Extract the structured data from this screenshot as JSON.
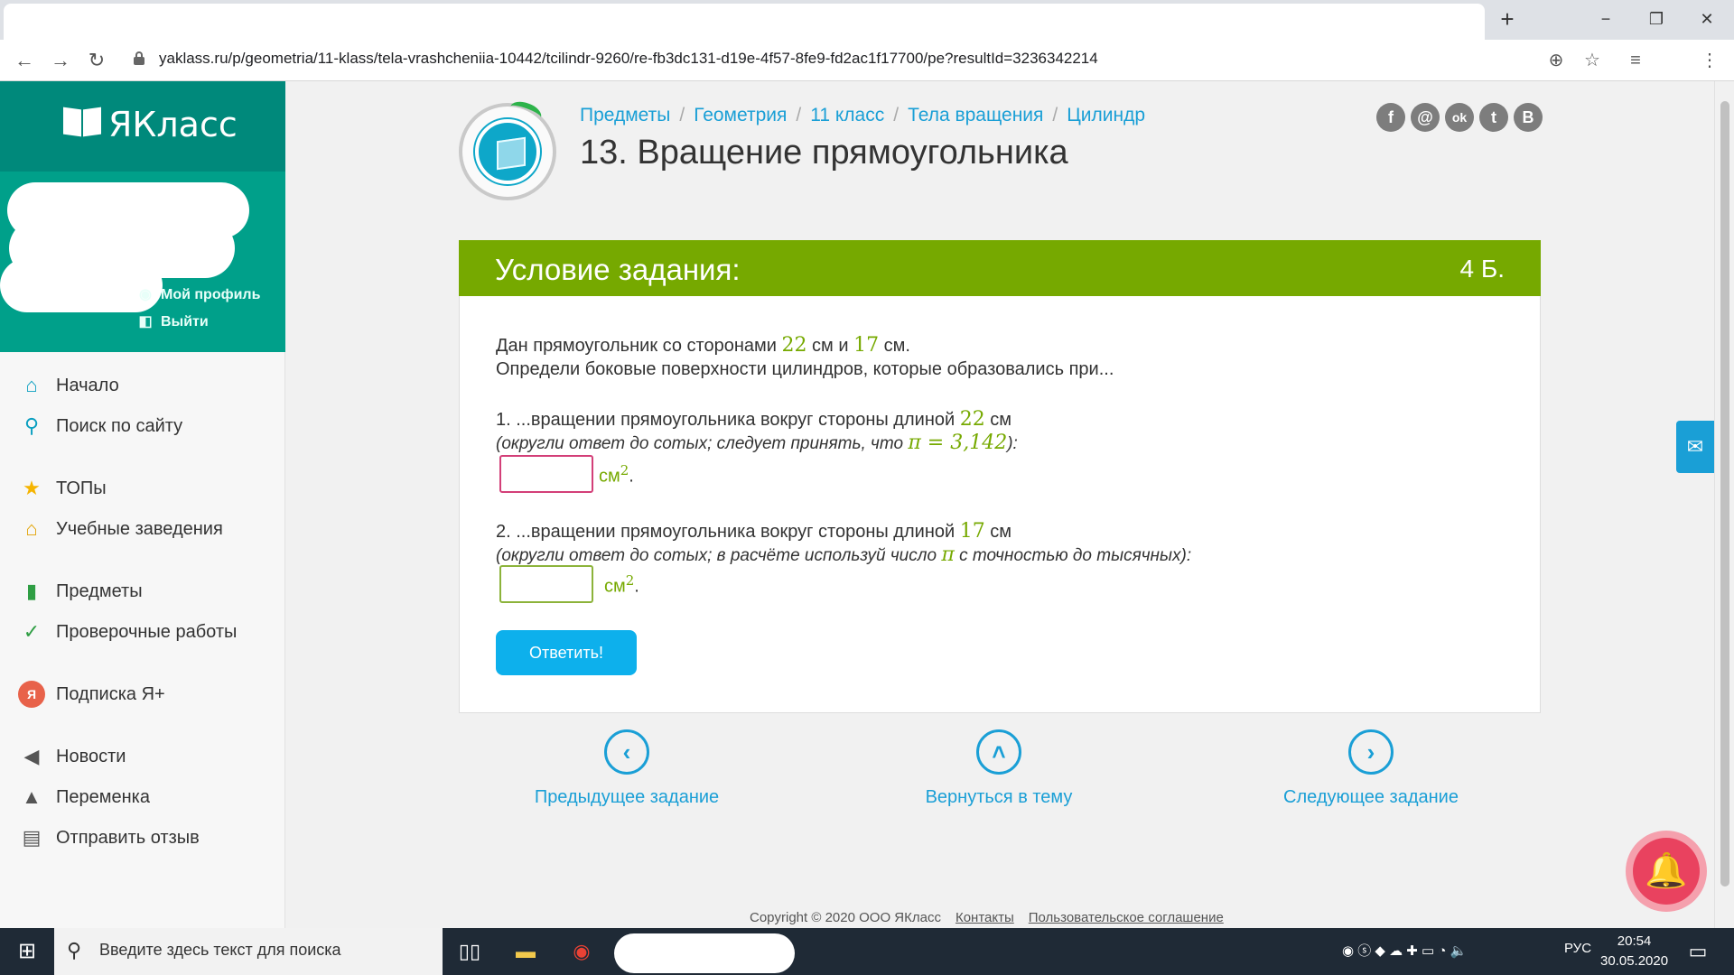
{
  "browser": {
    "url": "yaklass.ru/p/geometria/11-klass/tela-vrashcheniia-10442/tcilindr-9260/re-fb3dc131-d19e-4f57-8fe9-fd2ac1f17700/pe?resultId=3236342214",
    "new_tab": "+",
    "minimize": "−",
    "maximize": "❐",
    "close": "✕",
    "back": "←",
    "forward": "→",
    "reload": "↻",
    "add_icon": "⊕",
    "star_icon": "☆",
    "media_icon": "≡",
    "menu_icon": "⋮"
  },
  "sidebar": {
    "brand": "ЯКласс",
    "my_profile": "Мой профиль",
    "logout": "Выйти",
    "items": [
      {
        "label": "Начало",
        "icon": "⌂"
      },
      {
        "label": "Поиск по сайту",
        "icon": "⚲"
      },
      {
        "label": "ТОПы",
        "icon": "★"
      },
      {
        "label": "Учебные заведения",
        "icon": "⌂"
      },
      {
        "label": "Предметы",
        "icon": "▮"
      },
      {
        "label": "Проверочные работы",
        "icon": "✓"
      },
      {
        "label": "Подписка Я+",
        "icon": "Я"
      },
      {
        "label": "Новости",
        "icon": "◀"
      },
      {
        "label": "Переменка",
        "icon": "▲"
      },
      {
        "label": "Отправить отзыв",
        "icon": "▤"
      }
    ]
  },
  "breadcrumbs": [
    "Предметы",
    "Геометрия",
    "11 класс",
    "Тела вращения",
    "Цилиндр"
  ],
  "page_title": "13. Вращение прямоугольника",
  "social": [
    "f",
    "@",
    "ok",
    "t",
    "B"
  ],
  "task": {
    "header": "Условие задания:",
    "points": "4 Б.",
    "line1_a": "Дан прямоугольник со сторонами ",
    "side_a": "22",
    "line1_b": " см и ",
    "side_b": "17",
    "line1_c": " см.",
    "line2": "Определи боковые поверхности цилиндров, которые образовались при...",
    "q1_text": "1. ...вращении прямоугольника вокруг стороны длиной ",
    "q1_num": "22",
    "q1_unit": " см",
    "q1_hint_a": "(округли ответ до сотых; следует принять, что ",
    "q1_pi": "π = 3,142",
    "q1_hint_b": "):",
    "q2_text": "2. ...вращении прямоугольника вокруг стороны длиной ",
    "q2_num": "17",
    "q2_unit": " см",
    "q2_hint_a": "(округли ответ до сотых; в расчёте используй число ",
    "q2_pi": "π",
    "q2_hint_b": " с точностью до тысячных):",
    "answer_unit": "см",
    "answer_power": "2",
    "answer_dot": ".",
    "answer1_value": "",
    "answer2_value": "",
    "submit": "Ответить!"
  },
  "pager": {
    "prev": "Предыдущее задание",
    "up": "Вернуться в тему",
    "next": "Следующее задание"
  },
  "footer": {
    "copyright": "Copyright © 2020 ООО ЯКласс",
    "contacts": "Контакты",
    "agreement": "Пользовательское соглашение"
  },
  "taskbar": {
    "search_placeholder": "Введите здесь текст для поиска",
    "lang": "РУС",
    "time": "20:54",
    "date": "30.05.2020"
  },
  "colors": {
    "brand_teal": "#00897b",
    "task_green": "#76a900",
    "link_blue": "#1a9fd6",
    "button_blue": "#0db0ec",
    "input_error": "#d33f78",
    "bell_red": "#e9425f"
  }
}
